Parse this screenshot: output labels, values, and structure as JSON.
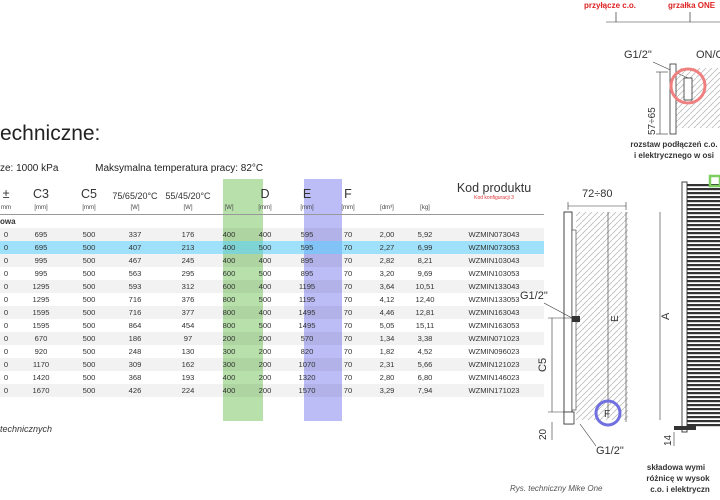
{
  "doc": {
    "title": "echniczne:",
    "pressure": "ze: 1000 kPa",
    "max_temp": "Maksymalna temperatura pracy: 82°C",
    "footnote": "technicznych",
    "caption": "Rys. techniczny Mike One"
  },
  "table": {
    "headers": [
      "±",
      "C3",
      "C5",
      "75/65/20°C",
      "55/45/20°C",
      "",
      "D",
      "E",
      "F",
      "",
      "",
      "Kod produktu"
    ],
    "header_sub": "Kod konfiguracji 3",
    "units": [
      "mm",
      "[mm]",
      "[mm]",
      "[W]",
      "[W]",
      "[W]",
      "[mm]",
      "[mm]",
      "[mm]",
      "[dm³]",
      "[kg]",
      ""
    ],
    "section": "owa",
    "rows": [
      [
        "0",
        "695",
        "500",
        "337",
        "176",
        "400",
        "400",
        "595",
        "70",
        "2,00",
        "5,92",
        "WZMIN073043"
      ],
      [
        "0",
        "695",
        "500",
        "407",
        "213",
        "400",
        "500",
        "595",
        "70",
        "2,27",
        "6,99",
        "WZMIN073053"
      ],
      [
        "0",
        "995",
        "500",
        "467",
        "245",
        "400",
        "400",
        "895",
        "70",
        "2,82",
        "8,21",
        "WZMIN103043"
      ],
      [
        "0",
        "995",
        "500",
        "563",
        "295",
        "600",
        "500",
        "895",
        "70",
        "3,20",
        "9,69",
        "WZMIN103053"
      ],
      [
        "0",
        "1295",
        "500",
        "593",
        "312",
        "600",
        "400",
        "1195",
        "70",
        "3,64",
        "10,51",
        "WZMIN133043"
      ],
      [
        "0",
        "1295",
        "500",
        "716",
        "376",
        "800",
        "500",
        "1195",
        "70",
        "4,12",
        "12,40",
        "WZMIN133053"
      ],
      [
        "0",
        "1595",
        "500",
        "716",
        "377",
        "800",
        "400",
        "1495",
        "70",
        "4,46",
        "12,81",
        "WZMIN163043"
      ],
      [
        "0",
        "1595",
        "500",
        "864",
        "454",
        "800",
        "500",
        "1495",
        "70",
        "5,05",
        "15,11",
        "WZMIN163053"
      ],
      [
        "0",
        "670",
        "500",
        "186",
        "97",
        "200",
        "200",
        "570",
        "70",
        "1,34",
        "3,38",
        "WZMIN071023"
      ],
      [
        "0",
        "920",
        "500",
        "248",
        "130",
        "300",
        "200",
        "820",
        "70",
        "1,82",
        "4,52",
        "WZMIN096023"
      ],
      [
        "0",
        "1170",
        "500",
        "309",
        "162",
        "300",
        "200",
        "1070",
        "70",
        "2,31",
        "5,66",
        "WZMIN121023"
      ],
      [
        "0",
        "1420",
        "500",
        "368",
        "193",
        "400",
        "200",
        "1320",
        "70",
        "2,80",
        "6,80",
        "WZMIN146023"
      ],
      [
        "0",
        "1670",
        "500",
        "426",
        "224",
        "400",
        "200",
        "1570",
        "70",
        "3,29",
        "7,94",
        "WZMIN171023"
      ]
    ],
    "selected_row": 1
  },
  "drawing": {
    "label_przylacze": "przyłącze c.o.",
    "label_grzalka": "grzałka ONE",
    "label_g12_top": "G1/2\"",
    "label_onoff": "ON/O",
    "label_57_65": "57÷65",
    "label_rozstaw": "rozstaw podłączeń c.o.",
    "label_rozstaw2": "i elektrycznego w osi",
    "label_72_80": "72÷80",
    "label_g12_mid": "G1/2\"",
    "label_e": "E",
    "label_a": "A",
    "label_c5": "C5",
    "label_f": "F",
    "label_20": "20",
    "label_g12_bot": "G1/2\"",
    "label_14": "14",
    "label_skladowa1": "składowa wymi",
    "label_skladowa2": "różnicę w wysok",
    "label_skladowa3": "c.o. i elektryczn",
    "accent_green": "#9fd58e",
    "accent_blue": "#a6a6f3",
    "accent_selected": "#50c8f5",
    "circle_red": "#f08080",
    "circle_blue": "#7070e0"
  }
}
